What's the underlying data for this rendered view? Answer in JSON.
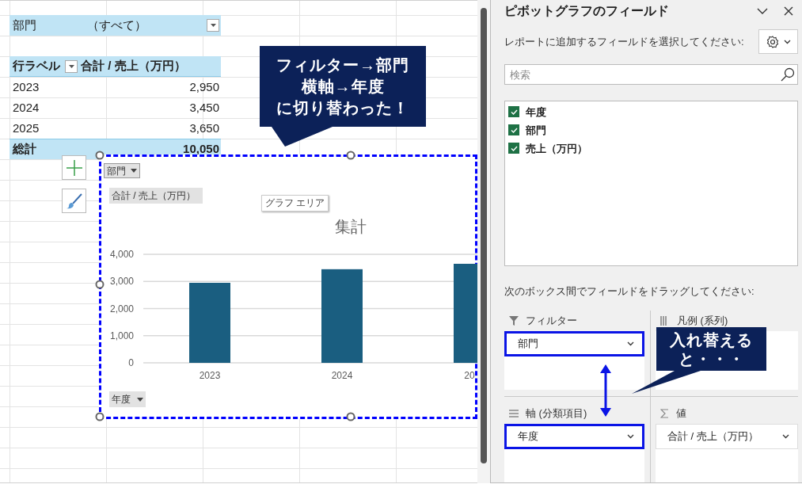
{
  "pivot_table": {
    "filter": {
      "field": "部門",
      "value": "（すべて）"
    },
    "header": {
      "row_label": "行ラベル",
      "value_label": "合計 / 売上（万円）"
    },
    "rows": [
      {
        "label": "2023",
        "value": "2,950"
      },
      {
        "label": "2024",
        "value": "3,450"
      },
      {
        "label": "2025",
        "value": "3,650"
      }
    ],
    "total": {
      "label": "総計",
      "value": "10,050"
    }
  },
  "chart": {
    "filter_button": "部門",
    "value_button": "合計 / 売上（万円）",
    "tooltip": "グラフ エリア",
    "axis_button": "年度",
    "chart_data": {
      "type": "bar",
      "title": "集計",
      "categories": [
        "2023",
        "2024",
        "20"
      ],
      "series": [
        {
          "color": "#1a5e80",
          "values": [
            2950,
            3450,
            3650
          ]
        }
      ],
      "grid": true,
      "ylim": [
        0,
        4000
      ],
      "yticks": [
        {
          "value": 0,
          "label": "0"
        },
        {
          "value": 1000,
          "label": "1,000"
        },
        {
          "value": 2000,
          "label": "2,000"
        },
        {
          "value": 3000,
          "label": "3,000"
        },
        {
          "value": 4000,
          "label": "4,000"
        }
      ]
    }
  },
  "callouts": [
    {
      "lines": [
        "フィルター→部門",
        "横軸→年度",
        "に切り替わった！"
      ]
    },
    {
      "lines": [
        "入れ替える",
        "と・・・"
      ]
    }
  ],
  "field_pane": {
    "title": "ピボットグラフのフィールド",
    "instruction": "レポートに追加するフィールドを選択してください:",
    "search": {
      "placeholder": "検索"
    },
    "fields": [
      {
        "label": "年度",
        "checked": true
      },
      {
        "label": "部門",
        "checked": true
      },
      {
        "label": "売上（万円）",
        "checked": true
      }
    ],
    "drag_instruction": "次のボックス間でフィールドをドラッグしてください:",
    "areas": [
      {
        "kind": "filter",
        "label": "フィルター",
        "items": [
          {
            "label": "部門",
            "highlighted": true
          }
        ]
      },
      {
        "kind": "legend",
        "label": "凡例 (系列)"
      },
      {
        "kind": "axis",
        "label": "軸 (分類項目)",
        "items": [
          {
            "label": "年度",
            "highlighted": true
          }
        ]
      },
      {
        "kind": "values",
        "label": "値",
        "items": [
          {
            "label": "合計 / 売上（万円）",
            "highlighted": false
          }
        ]
      }
    ]
  }
}
